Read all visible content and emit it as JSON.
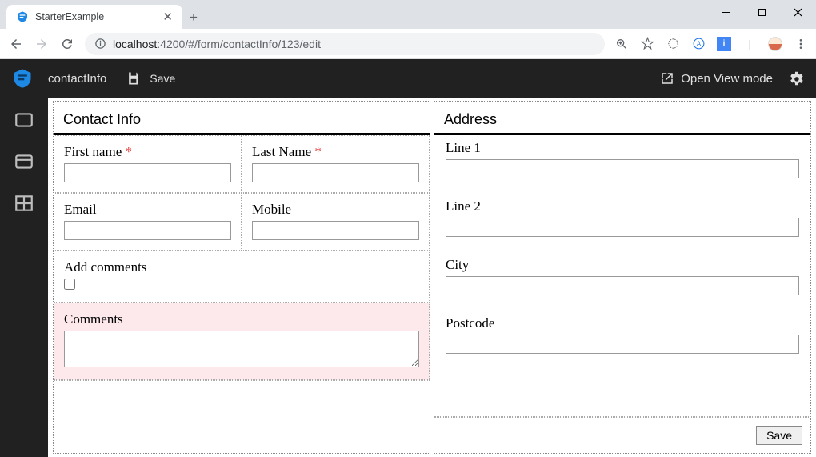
{
  "browser": {
    "tab_title": "StarterExample",
    "url_host": "localhost",
    "url_port": ":4200",
    "url_path": "/#/form/contactInfo/123/edit"
  },
  "app": {
    "title": "contactInfo",
    "save_label": "Save",
    "open_view_label": "Open View mode"
  },
  "contactPanel": {
    "heading": "Contact Info",
    "firstName": {
      "label": "First name",
      "required": true,
      "value": ""
    },
    "lastName": {
      "label": "Last Name",
      "required": true,
      "value": ""
    },
    "email": {
      "label": "Email",
      "value": ""
    },
    "mobile": {
      "label": "Mobile",
      "value": ""
    },
    "addComments": {
      "label": "Add comments",
      "checked": false
    },
    "comments": {
      "label": "Comments",
      "value": ""
    }
  },
  "addressPanel": {
    "heading": "Address",
    "line1": {
      "label": "Line 1",
      "value": ""
    },
    "line2": {
      "label": "Line 2",
      "value": ""
    },
    "city": {
      "label": "City",
      "value": ""
    },
    "postcode": {
      "label": "Postcode",
      "value": ""
    },
    "save_button": "Save"
  }
}
